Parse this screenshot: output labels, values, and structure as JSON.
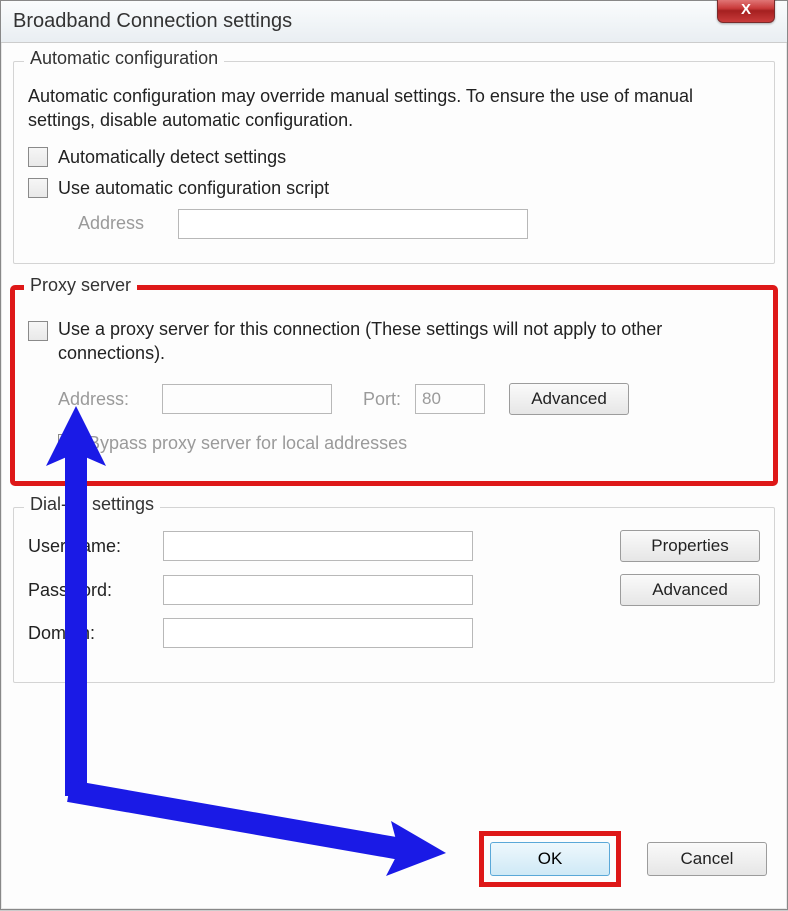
{
  "window": {
    "title": "Broadband Connection settings"
  },
  "auto": {
    "group_title": "Automatic configuration",
    "description": "Automatic configuration may override manual settings.  To ensure the use of manual settings, disable automatic configuration.",
    "detect_label": "Automatically detect settings",
    "script_label": "Use automatic configuration script",
    "address_label": "Address"
  },
  "proxy": {
    "group_title": "Proxy server",
    "use_label": "Use a proxy server for this connection (These settings will not apply to other connections).",
    "address_label": "Address:",
    "port_label": "Port:",
    "port_value": "80",
    "advanced_label": "Advanced",
    "bypass_label": "Bypass proxy server for local addresses"
  },
  "dialup": {
    "group_title": "Dial-up settings",
    "user_label": "User name:",
    "password_label": "Password:",
    "domain_label": "Domain:",
    "properties_label": "Properties",
    "advanced_label": "Advanced"
  },
  "buttons": {
    "ok": "OK",
    "cancel": "Cancel",
    "close": "X"
  },
  "highlight_color": "#de1818",
  "arrow_color": "#1a1ae6"
}
